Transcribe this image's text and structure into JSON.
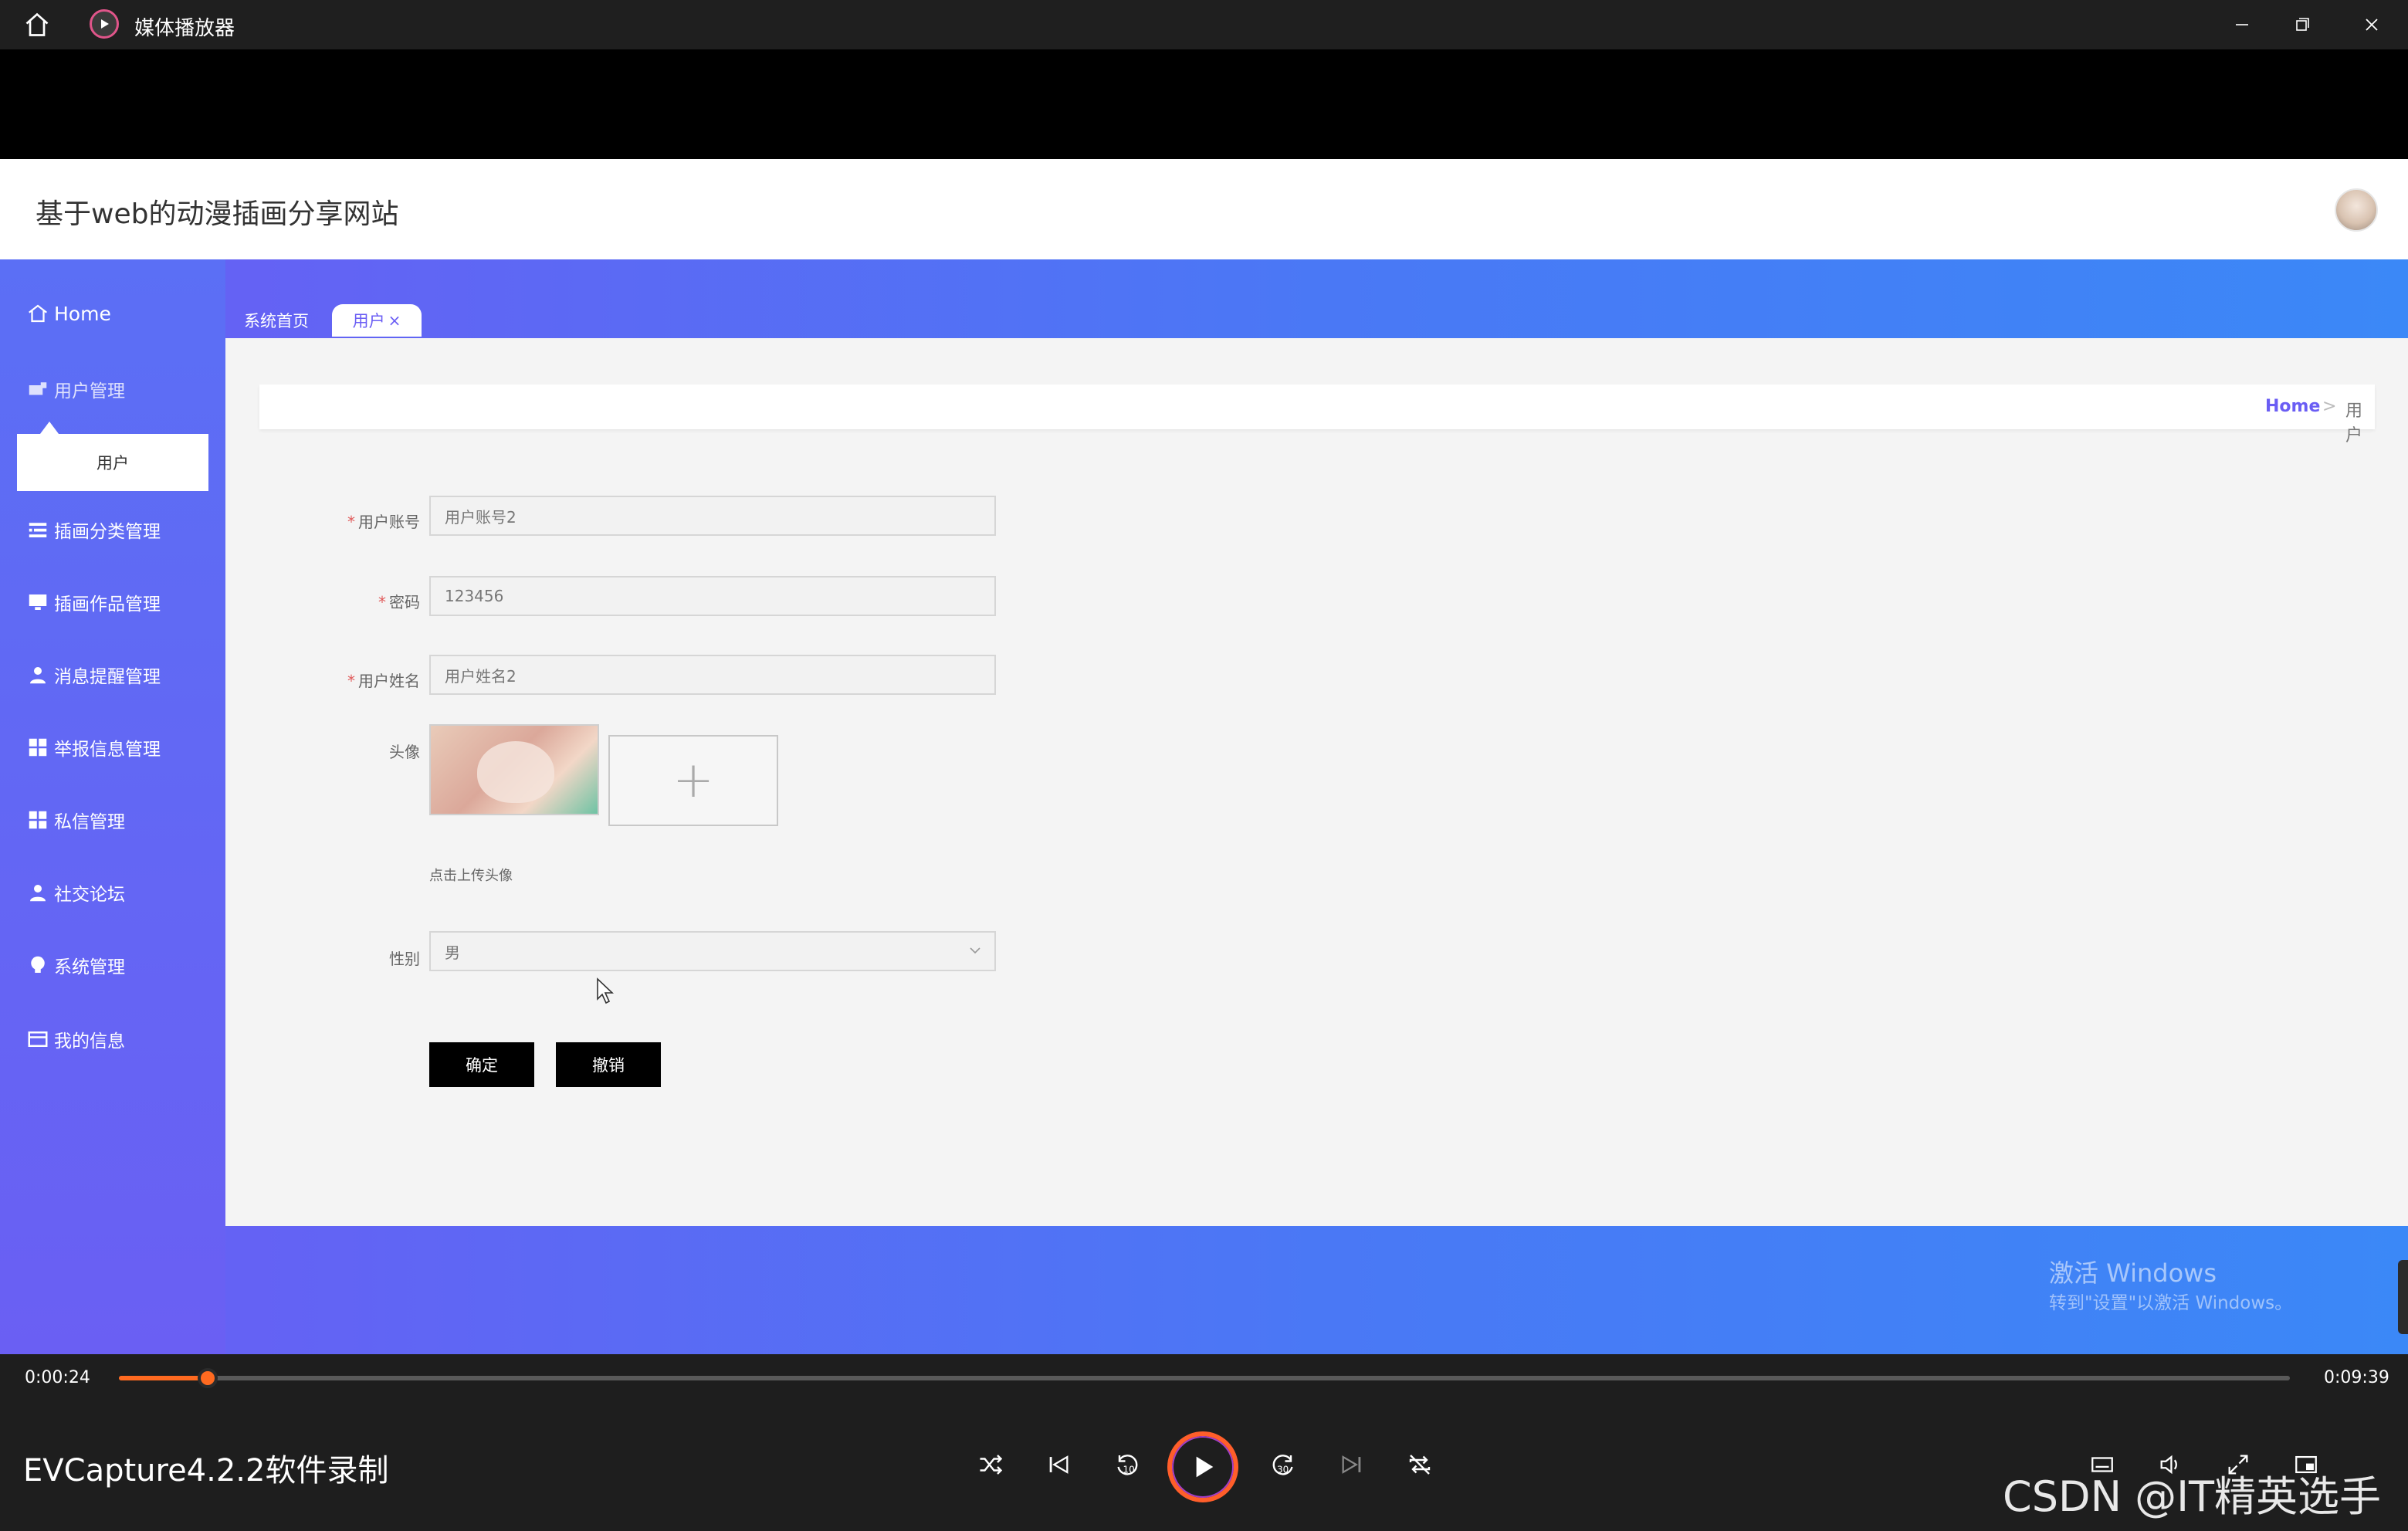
{
  "window": {
    "title": "媒体播放器",
    "home_icon": "home-icon",
    "app_icon": "media-player-icon"
  },
  "app": {
    "site_title": "基于web的动漫插画分享网站",
    "nav": {
      "home": "Home",
      "user_mgmt": "用户管理",
      "user_sub": "用户",
      "category_mgmt": "插画分类管理",
      "works_mgmt": "插画作品管理",
      "message_mgmt": "消息提醒管理",
      "report_mgmt": "举报信息管理",
      "pm_mgmt": "私信管理",
      "forum": "社交论坛",
      "system_mgmt": "系统管理",
      "my_info": "我的信息"
    },
    "tabs": {
      "home": "系统首页",
      "user": "用户"
    },
    "breadcrumb": {
      "home": "Home",
      "sep": ">",
      "current": "用户"
    },
    "form": {
      "account_label": "用户账号",
      "account_value": "用户账号2",
      "password_label": "密码",
      "password_value": "123456",
      "name_label": "用户姓名",
      "name_value": "用户姓名2",
      "avatar_label": "头像",
      "upload_plus": "+",
      "upload_hint": "点击上传头像",
      "gender_label": "性别",
      "gender_value": "男",
      "required_mark": "*",
      "confirm": "确定",
      "cancel": "撤销"
    },
    "watermark": {
      "line1": "激活 Windows",
      "line2": "转到\"设置\"以激活 Windows。"
    }
  },
  "player": {
    "current_time": "0:00:24",
    "total_time": "0:09:39",
    "progress_fraction": 0.041,
    "video_name": "EVCapture4.2.2软件录制",
    "csdn": "CSDN @IT精英选手",
    "accent": "#ff6a20"
  }
}
